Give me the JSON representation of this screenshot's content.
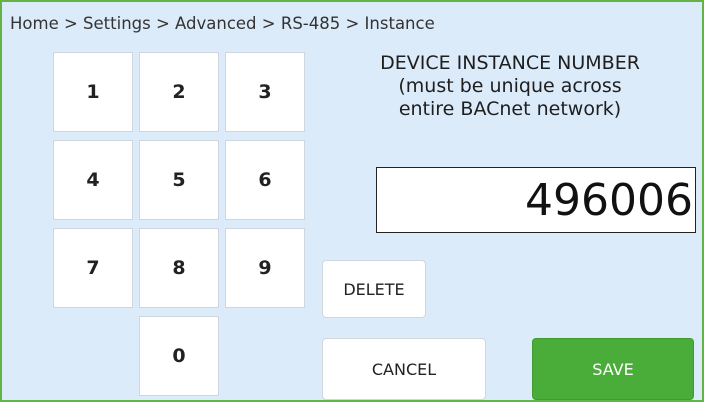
{
  "breadcrumb": "Home > Settings > Advanced > RS-485 > Instance",
  "title": {
    "line1": "DEVICE INSTANCE NUMBER",
    "line2": "(must be unique across",
    "line3": "entire BACnet network)"
  },
  "value": "496006",
  "keypad": [
    "1",
    "2",
    "3",
    "4",
    "5",
    "6",
    "7",
    "8",
    "9",
    "0"
  ],
  "buttons": {
    "delete": "DELETE",
    "cancel": "CANCEL",
    "save": "SAVE"
  },
  "colors": {
    "background": "#dcebfa",
    "frame_border": "#62b544",
    "save_button": "#4aad3a"
  }
}
